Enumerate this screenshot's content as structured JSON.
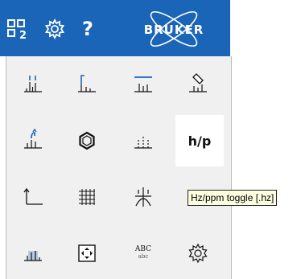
{
  "toolbar": {
    "layout_icon": "layout-2-icon",
    "layout_badge": "2",
    "settings_icon": "gear-icon",
    "help_label": "?",
    "logo_text": "BRUKER"
  },
  "tools": [
    {
      "icon": "peak-picking-icon"
    },
    {
      "icon": "integration-icon"
    },
    {
      "icon": "baseline-icon"
    },
    {
      "icon": "eraser-spectrum-icon"
    },
    {
      "icon": "phase-correction-icon"
    },
    {
      "icon": "molecule-icon"
    },
    {
      "icon": "multiplet-icon"
    },
    {
      "icon": "hz-ppm-toggle-icon",
      "label": "h/p"
    },
    {
      "icon": "axis-icon"
    },
    {
      "icon": "grid-icon"
    },
    {
      "icon": "contour-icon"
    },
    {
      "icon": "spectrum-grid-icon"
    },
    {
      "icon": "spectrum-region-icon"
    },
    {
      "icon": "fit-to-window-icon"
    },
    {
      "icon": "text-annotation-icon",
      "label_top": "ABC",
      "label_bottom": "abc"
    },
    {
      "icon": "settings-icon"
    }
  ],
  "tooltip": {
    "text": "Hz/ppm toggle [.hz]"
  }
}
